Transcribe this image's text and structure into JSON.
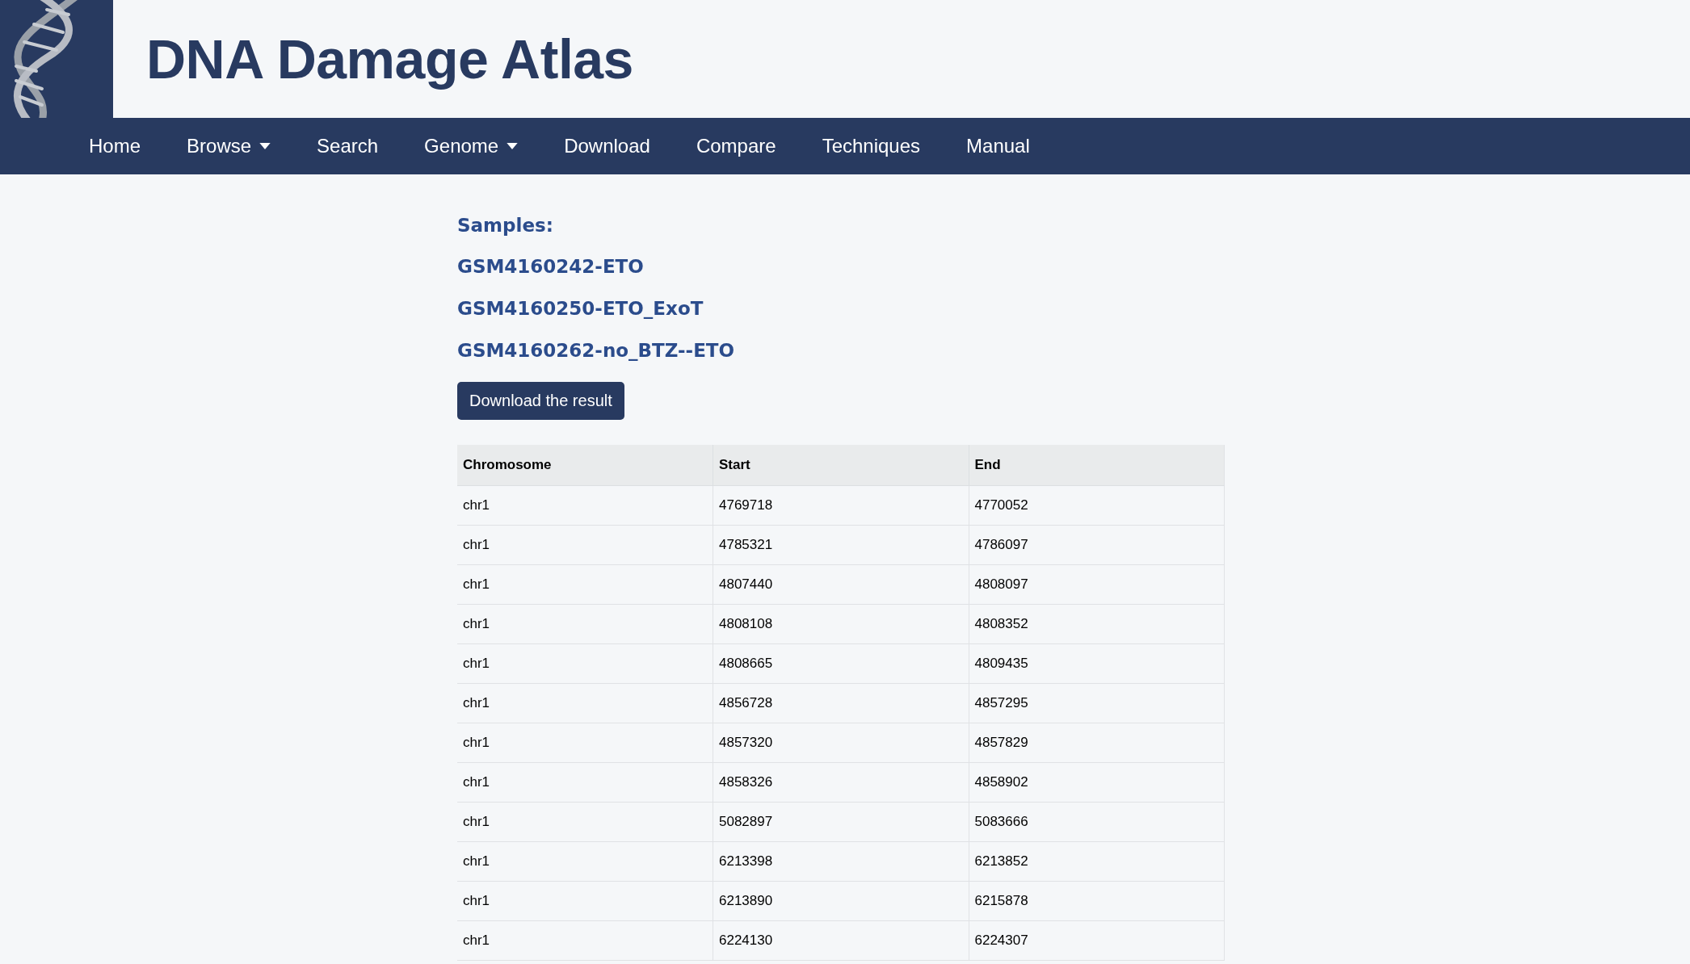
{
  "site": {
    "title": "DNA Damage Atlas"
  },
  "nav": [
    {
      "label": "Home",
      "dropdown": false
    },
    {
      "label": "Browse",
      "dropdown": true
    },
    {
      "label": "Search",
      "dropdown": false
    },
    {
      "label": "Genome",
      "dropdown": true
    },
    {
      "label": "Download",
      "dropdown": false
    },
    {
      "label": "Compare",
      "dropdown": false
    },
    {
      "label": "Techniques",
      "dropdown": false
    },
    {
      "label": "Manual",
      "dropdown": false
    }
  ],
  "samples": {
    "heading": "Samples:",
    "items": [
      "GSM4160242-ETO",
      "GSM4160250-ETO_ExoT",
      "GSM4160262-no_BTZ--ETO"
    ]
  },
  "download_button": "Download the result",
  "table": {
    "columns": [
      "Chromosome",
      "Start",
      "End"
    ],
    "rows": [
      [
        "chr1",
        "4769718",
        "4770052"
      ],
      [
        "chr1",
        "4785321",
        "4786097"
      ],
      [
        "chr1",
        "4807440",
        "4808097"
      ],
      [
        "chr1",
        "4808108",
        "4808352"
      ],
      [
        "chr1",
        "4808665",
        "4809435"
      ],
      [
        "chr1",
        "4856728",
        "4857295"
      ],
      [
        "chr1",
        "4857320",
        "4857829"
      ],
      [
        "chr1",
        "4858326",
        "4858902"
      ],
      [
        "chr1",
        "5082897",
        "5083666"
      ],
      [
        "chr1",
        "6213398",
        "6213852"
      ],
      [
        "chr1",
        "6213890",
        "6215878"
      ],
      [
        "chr1",
        "6224130",
        "6224307"
      ]
    ]
  }
}
